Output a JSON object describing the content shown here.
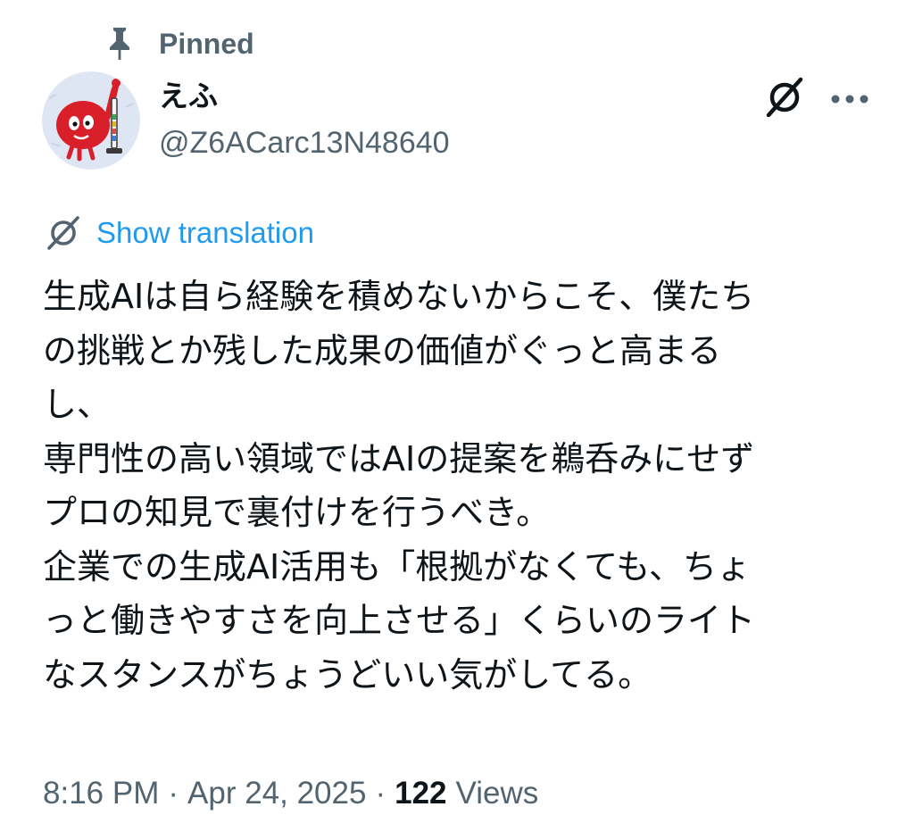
{
  "pinned": {
    "label": "Pinned"
  },
  "author": {
    "display_name": "えふ",
    "handle": "@Z6ACarc13N48640"
  },
  "translation": {
    "label": "Show translation"
  },
  "tweet": {
    "lines": [
      "生成AIは自ら経験を積めないからこそ、僕たち",
      "の挑戦とか残した成果の価値がぐっと高まる",
      "し、",
      "専門性の高い領域ではAIの提案を鵜呑みにせず",
      "プロの知見で裏付けを行うべき。",
      "企業での生成AI活用も「根拠がなくても、ちょ",
      "っと働きやすさを向上させる」くらいのライト",
      "なスタンスがちょうどいい気がしてる。"
    ]
  },
  "meta": {
    "time": "8:16 PM",
    "separator": "·",
    "date": "Apr 24, 2025",
    "views_count": "122",
    "views_label": "Views"
  },
  "colors": {
    "text_primary": "#0f1419",
    "text_secondary": "#536471",
    "link": "#1d9bf0",
    "avatar_mascot": "#d81f2a",
    "avatar_bg": "#dfe6f3"
  },
  "icons": {
    "pin": "pin-icon",
    "grok": "grok-icon",
    "more": "more-icon",
    "translate": "translate-icon"
  }
}
